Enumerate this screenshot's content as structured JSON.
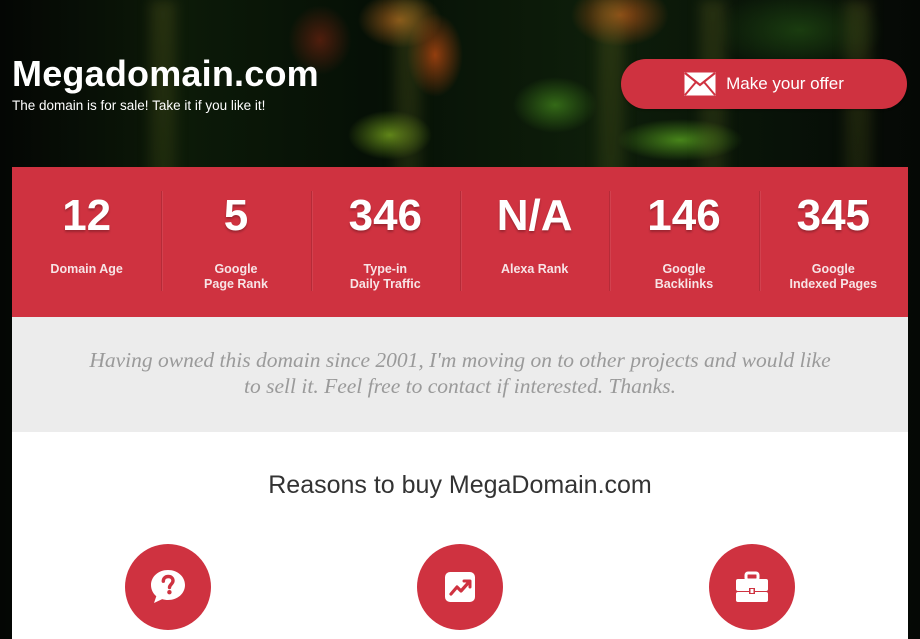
{
  "header": {
    "title": "Megadomain.com",
    "subtitle": "The domain is for sale! Take it if you like it!"
  },
  "offer_button": {
    "label": "Make your offer",
    "icon": "envelope-icon"
  },
  "stats": [
    {
      "value": "12",
      "label": "Domain Age"
    },
    {
      "value": "5",
      "label": "Google\nPage Rank"
    },
    {
      "value": "346",
      "label": "Type-in\nDaily Traffic"
    },
    {
      "value": "N/A",
      "label": "Alexa Rank"
    },
    {
      "value": "146",
      "label": "Google\nBacklinks"
    },
    {
      "value": "345",
      "label": "Google\nIndexed Pages"
    }
  ],
  "quote": "Having owned this domain since 2001, I'm moving on to other projects and would like to sell it. Feel free to contact if interested. Thanks.",
  "reasons": {
    "title": "Reasons to buy MegaDomain.com",
    "icons": [
      "question-bubble-icon",
      "chart-trend-icon",
      "briefcase-icon"
    ]
  },
  "colors": {
    "accent": "#cf3240",
    "quote_band": "#ececec",
    "quote_text": "#9a9a9a"
  }
}
